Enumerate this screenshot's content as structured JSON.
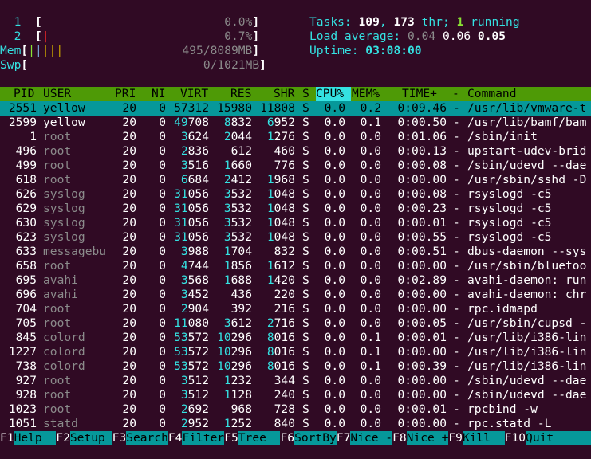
{
  "meters": {
    "cpu1": {
      "label": "1",
      "value": "0.0%"
    },
    "cpu2": {
      "label": "2",
      "value": "0.7%"
    },
    "mem": {
      "label": "Mem",
      "value": "495/8089MB"
    },
    "swp": {
      "label": "Swp",
      "value": "0/1021MB"
    }
  },
  "stats": {
    "tasks_label": "Tasks: ",
    "tasks": "109",
    "thr": "173",
    "thr_label": " thr; ",
    "running": "1",
    "running_label": " running",
    "load_label": "Load average: ",
    "load1": "0.04",
    "load5": "0.06",
    "load15": "0.05",
    "uptime_label": "Uptime: ",
    "uptime": "03:08:00"
  },
  "columns": [
    "PID",
    "USER",
    "PRI",
    "NI",
    "VIRT",
    "RES",
    "SHR",
    "S",
    "CPU%",
    "MEM%",
    "TIME+",
    "-",
    "Command"
  ],
  "processes": [
    {
      "pid": "2551",
      "user": "yellow",
      "pri": "20",
      "ni": "0",
      "virt": "57312",
      "res": "15980",
      "shr": "11808",
      "s": "S",
      "cpu": "0.0",
      "mem": "0.2",
      "time": "0:09.46",
      "cmd": "/usr/lib/vmware-t"
    },
    {
      "pid": "2599",
      "user": "yellow",
      "pri": "20",
      "ni": "0",
      "virt": "49708",
      "res": "8832",
      "shr": "6952",
      "s": "S",
      "cpu": "0.0",
      "mem": "0.1",
      "time": "0:00.50",
      "cmd": "/usr/lib/bamf/bam"
    },
    {
      "pid": "1",
      "user": "root",
      "pri": "20",
      "ni": "0",
      "virt": "3624",
      "res": "2044",
      "shr": "1276",
      "s": "S",
      "cpu": "0.0",
      "mem": "0.0",
      "time": "0:01.06",
      "cmd": "/sbin/init"
    },
    {
      "pid": "496",
      "user": "root",
      "pri": "20",
      "ni": "0",
      "virt": "2836",
      "res": "612",
      "shr": "460",
      "s": "S",
      "cpu": "0.0",
      "mem": "0.0",
      "time": "0:00.13",
      "cmd": "upstart-udev-brid"
    },
    {
      "pid": "499",
      "user": "root",
      "pri": "20",
      "ni": "0",
      "virt": "3516",
      "res": "1660",
      "shr": "776",
      "s": "S",
      "cpu": "0.0",
      "mem": "0.0",
      "time": "0:00.08",
      "cmd": "/sbin/udevd --dae"
    },
    {
      "pid": "618",
      "user": "root",
      "pri": "20",
      "ni": "0",
      "virt": "6684",
      "res": "2412",
      "shr": "1968",
      "s": "S",
      "cpu": "0.0",
      "mem": "0.0",
      "time": "0:00.00",
      "cmd": "/usr/sbin/sshd -D"
    },
    {
      "pid": "626",
      "user": "syslog",
      "pri": "20",
      "ni": "0",
      "virt": "31056",
      "res": "3532",
      "shr": "1048",
      "s": "S",
      "cpu": "0.0",
      "mem": "0.0",
      "time": "0:00.08",
      "cmd": "rsyslogd -c5"
    },
    {
      "pid": "629",
      "user": "syslog",
      "pri": "20",
      "ni": "0",
      "virt": "31056",
      "res": "3532",
      "shr": "1048",
      "s": "S",
      "cpu": "0.0",
      "mem": "0.0",
      "time": "0:00.23",
      "cmd": "rsyslogd -c5"
    },
    {
      "pid": "630",
      "user": "syslog",
      "pri": "20",
      "ni": "0",
      "virt": "31056",
      "res": "3532",
      "shr": "1048",
      "s": "S",
      "cpu": "0.0",
      "mem": "0.0",
      "time": "0:00.01",
      "cmd": "rsyslogd -c5"
    },
    {
      "pid": "623",
      "user": "syslog",
      "pri": "20",
      "ni": "0",
      "virt": "31056",
      "res": "3532",
      "shr": "1048",
      "s": "S",
      "cpu": "0.0",
      "mem": "0.0",
      "time": "0:00.55",
      "cmd": "rsyslogd -c5"
    },
    {
      "pid": "633",
      "user": "messagebu",
      "pri": "20",
      "ni": "0",
      "virt": "3988",
      "res": "1704",
      "shr": "832",
      "s": "S",
      "cpu": "0.0",
      "mem": "0.0",
      "time": "0:00.51",
      "cmd": "dbus-daemon --sys"
    },
    {
      "pid": "658",
      "user": "root",
      "pri": "20",
      "ni": "0",
      "virt": "4744",
      "res": "1856",
      "shr": "1612",
      "s": "S",
      "cpu": "0.0",
      "mem": "0.0",
      "time": "0:00.00",
      "cmd": "/usr/sbin/bluetoo"
    },
    {
      "pid": "695",
      "user": "avahi",
      "pri": "20",
      "ni": "0",
      "virt": "3568",
      "res": "1688",
      "shr": "1420",
      "s": "S",
      "cpu": "0.0",
      "mem": "0.0",
      "time": "0:02.89",
      "cmd": "avahi-daemon: run"
    },
    {
      "pid": "696",
      "user": "avahi",
      "pri": "20",
      "ni": "0",
      "virt": "3452",
      "res": "436",
      "shr": "220",
      "s": "S",
      "cpu": "0.0",
      "mem": "0.0",
      "time": "0:00.00",
      "cmd": "avahi-daemon: chr"
    },
    {
      "pid": "704",
      "user": "root",
      "pri": "20",
      "ni": "0",
      "virt": "2904",
      "res": "392",
      "shr": "216",
      "s": "S",
      "cpu": "0.0",
      "mem": "0.0",
      "time": "0:00.00",
      "cmd": "rpc.idmapd"
    },
    {
      "pid": "705",
      "user": "root",
      "pri": "20",
      "ni": "0",
      "virt": "11080",
      "res": "3612",
      "shr": "2716",
      "s": "S",
      "cpu": "0.0",
      "mem": "0.0",
      "time": "0:00.05",
      "cmd": "/usr/sbin/cupsd -"
    },
    {
      "pid": "845",
      "user": "colord",
      "pri": "20",
      "ni": "0",
      "virt": "53572",
      "res": "10296",
      "shr": "8016",
      "s": "S",
      "cpu": "0.0",
      "mem": "0.1",
      "time": "0:00.01",
      "cmd": "/usr/lib/i386-lin"
    },
    {
      "pid": "1227",
      "user": "colord",
      "pri": "20",
      "ni": "0",
      "virt": "53572",
      "res": "10296",
      "shr": "8016",
      "s": "S",
      "cpu": "0.0",
      "mem": "0.1",
      "time": "0:00.00",
      "cmd": "/usr/lib/i386-lin"
    },
    {
      "pid": "738",
      "user": "colord",
      "pri": "20",
      "ni": "0",
      "virt": "53572",
      "res": "10296",
      "shr": "8016",
      "s": "S",
      "cpu": "0.0",
      "mem": "0.1",
      "time": "0:00.39",
      "cmd": "/usr/lib/i386-lin"
    },
    {
      "pid": "927",
      "user": "root",
      "pri": "20",
      "ni": "0",
      "virt": "3512",
      "res": "1232",
      "shr": "344",
      "s": "S",
      "cpu": "0.0",
      "mem": "0.0",
      "time": "0:00.00",
      "cmd": "/sbin/udevd --dae"
    },
    {
      "pid": "928",
      "user": "root",
      "pri": "20",
      "ni": "0",
      "virt": "3512",
      "res": "1128",
      "shr": "240",
      "s": "S",
      "cpu": "0.0",
      "mem": "0.0",
      "time": "0:00.00",
      "cmd": "/sbin/udevd --dae"
    },
    {
      "pid": "1023",
      "user": "root",
      "pri": "20",
      "ni": "0",
      "virt": "2692",
      "res": "968",
      "shr": "728",
      "s": "S",
      "cpu": "0.0",
      "mem": "0.0",
      "time": "0:00.01",
      "cmd": "rpcbind -w"
    },
    {
      "pid": "1051",
      "user": "statd",
      "pri": "20",
      "ni": "0",
      "virt": "2952",
      "res": "1252",
      "shr": "840",
      "s": "S",
      "cpu": "0.0",
      "mem": "0.0",
      "time": "0:00.00",
      "cmd": "rpc.statd -L"
    }
  ],
  "footer": [
    {
      "key": "F1",
      "label": "Help  "
    },
    {
      "key": "F2",
      "label": "Setup "
    },
    {
      "key": "F3",
      "label": "Search"
    },
    {
      "key": "F4",
      "label": "Filter"
    },
    {
      "key": "F5",
      "label": "Tree  "
    },
    {
      "key": "F6",
      "label": "SortBy"
    },
    {
      "key": "F7",
      "label": "Nice -"
    },
    {
      "key": "F8",
      "label": "Nice +"
    },
    {
      "key": "F9",
      "label": "Kill  "
    },
    {
      "key": "F10",
      "label": "Quit  "
    }
  ],
  "colors": {
    "background": "#300a24",
    "header": "#4e9a06",
    "selected": "#06989a",
    "accent": "#34e2e2",
    "green": "#8ae234"
  }
}
